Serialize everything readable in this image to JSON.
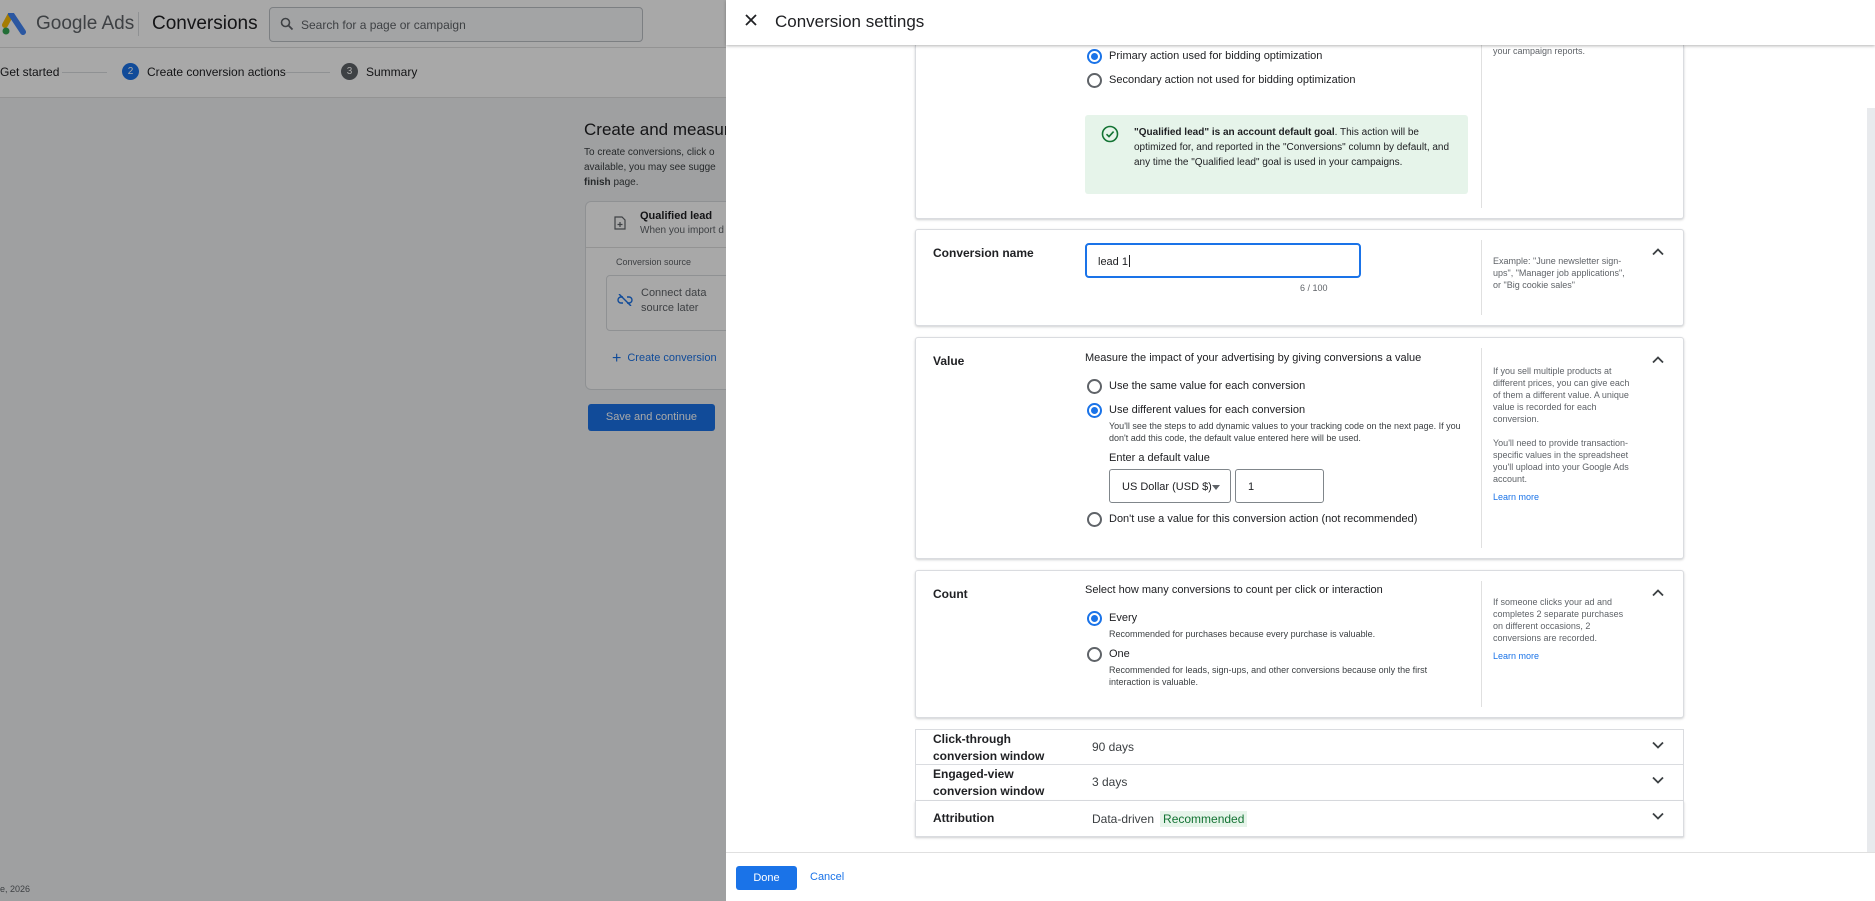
{
  "background": {
    "brand": "Google Ads",
    "page_title": "Conversions",
    "search_placeholder": "Search for a page or campaign",
    "steps": [
      {
        "label": "Get started"
      },
      {
        "num": "2",
        "label": "Create conversion actions"
      },
      {
        "num": "3",
        "label": "Summary"
      }
    ],
    "heading": "Create and measur",
    "intro_lines": [
      "To create conversions, click o",
      "available, you may see sugge",
      "page."
    ],
    "intro_bold": "finish",
    "card": {
      "title": "Qualified lead",
      "subtitle": "When you import d",
      "source_label": "Conversion source",
      "source_text": "Connect data source later",
      "add_link": "Create conversion"
    },
    "save_button": "Save and continue",
    "footer": "e, 2026"
  },
  "panel": {
    "title": "Conversion settings",
    "goal_card": {
      "help_top": "your campaign reports.",
      "options": [
        {
          "label": "Primary action used for bidding optimization",
          "selected": true
        },
        {
          "label": "Secondary action not used for bidding optimization",
          "selected": false
        }
      ],
      "notice_bold": "\"Qualified lead\" is an account default goal",
      "notice_text": ". This action will be optimized for, and reported in the \"Conversions\" column by default, and any time the \"Qualified lead\" goal is used in your campaigns."
    },
    "name_card": {
      "label": "Conversion name",
      "value": "lead 1",
      "counter": "6 / 100",
      "help": "Example: \"June newsletter sign-ups\", \"Manager job applications\", or \"Big cookie sales\""
    },
    "value_card": {
      "label": "Value",
      "description": "Measure the impact of your advertising by giving conversions a value",
      "options": [
        {
          "label": "Use the same value for each conversion",
          "selected": false
        },
        {
          "label": "Use different values for each conversion",
          "selected": true,
          "sub": "You'll see the steps to add dynamic values to your tracking code on the next page. If you don't add this code, the default value entered here will be used."
        },
        {
          "label": "Don't use a value for this conversion action (not recommended)",
          "selected": false
        }
      ],
      "default_label": "Enter a default value",
      "currency": "US Dollar (USD $)",
      "amount": "1",
      "help1": "If you sell multiple products at different prices, you can give each of them a different value. A unique value is recorded for each conversion.",
      "help2": "You'll need to provide transaction-specific values in the spreadsheet you'll upload into your Google Ads account.",
      "learn_more": "Learn more"
    },
    "count_card": {
      "label": "Count",
      "description": "Select how many conversions to count per click or interaction",
      "options": [
        {
          "label": "Every",
          "sub": "Recommended for purchases because every purchase is valuable.",
          "selected": true
        },
        {
          "label": "One",
          "sub": "Recommended for leads, sign-ups, and other conversions because only the first interaction is valuable.",
          "selected": false
        }
      ],
      "help": "If someone clicks your ad and completes 2 separate purchases on different occasions, 2 conversions are recorded.",
      "learn_more": "Learn more"
    },
    "collapsed_rows": [
      {
        "label": "Click-through conversion window",
        "value": "90 days"
      },
      {
        "label": "Engaged-view conversion window",
        "value": "3 days"
      },
      {
        "label": "Attribution",
        "value": "Data-driven",
        "badge": "Recommended"
      }
    ],
    "done_button": "Done",
    "cancel_button": "Cancel"
  },
  "colors": {
    "accent": "#1a73e8",
    "success_bg": "#e6f4ea",
    "success_text": "#137333"
  }
}
